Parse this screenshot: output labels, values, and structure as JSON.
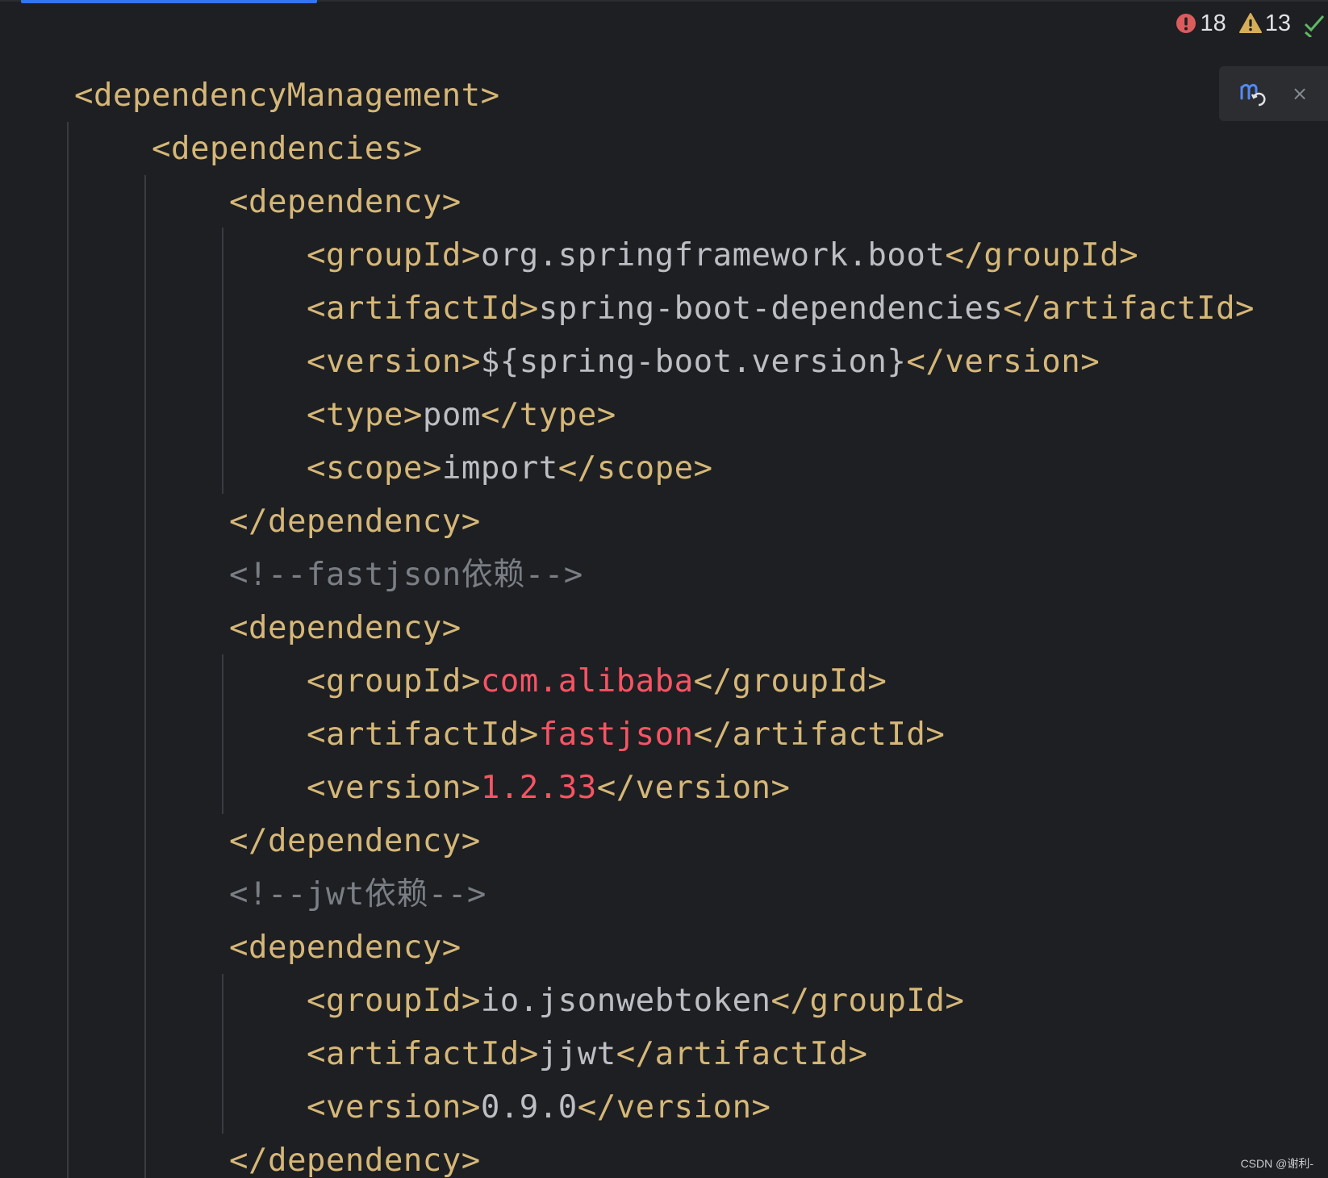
{
  "inspections": {
    "errors": "18",
    "warnings": "13"
  },
  "maven_popup": {
    "icon": "maven-reload-icon",
    "close_glyph": "×"
  },
  "code_lines": [
    {
      "indent": 1,
      "segments": [
        {
          "t": "<dependencyManagement>",
          "k": "tag"
        }
      ]
    },
    {
      "indent": 2,
      "segments": [
        {
          "t": "<dependencies>",
          "k": "tag"
        }
      ]
    },
    {
      "indent": 3,
      "segments": [
        {
          "t": "<dependency>",
          "k": "tag"
        }
      ]
    },
    {
      "indent": 4,
      "segments": [
        {
          "t": "<groupId>",
          "k": "tag"
        },
        {
          "t": "org.springframework.boot",
          "k": "text"
        },
        {
          "t": "</groupId>",
          "k": "tag"
        }
      ]
    },
    {
      "indent": 4,
      "segments": [
        {
          "t": "<artifactId>",
          "k": "tag"
        },
        {
          "t": "spring-boot-dependencies",
          "k": "text"
        },
        {
          "t": "</artifactId>",
          "k": "tag"
        }
      ]
    },
    {
      "indent": 4,
      "segments": [
        {
          "t": "<version>",
          "k": "tag"
        },
        {
          "t": "${spring-boot.version}",
          "k": "text"
        },
        {
          "t": "</version>",
          "k": "tag"
        }
      ]
    },
    {
      "indent": 4,
      "segments": [
        {
          "t": "<type>",
          "k": "tag"
        },
        {
          "t": "pom",
          "k": "text"
        },
        {
          "t": "</type>",
          "k": "tag"
        }
      ]
    },
    {
      "indent": 4,
      "segments": [
        {
          "t": "<scope>",
          "k": "tag"
        },
        {
          "t": "import",
          "k": "text"
        },
        {
          "t": "</scope>",
          "k": "tag"
        }
      ]
    },
    {
      "indent": 3,
      "segments": [
        {
          "t": "</dependency>",
          "k": "tag"
        }
      ]
    },
    {
      "indent": 3,
      "segments": [
        {
          "t": "<!--fastjson依赖-->",
          "k": "comment"
        }
      ]
    },
    {
      "indent": 3,
      "segments": [
        {
          "t": "<dependency>",
          "k": "tag"
        }
      ]
    },
    {
      "indent": 4,
      "segments": [
        {
          "t": "<groupId>",
          "k": "tag"
        },
        {
          "t": "com.alibaba",
          "k": "err"
        },
        {
          "t": "</groupId>",
          "k": "tag"
        }
      ]
    },
    {
      "indent": 4,
      "segments": [
        {
          "t": "<artifactId>",
          "k": "tag"
        },
        {
          "t": "fastjson",
          "k": "err"
        },
        {
          "t": "</artifactId>",
          "k": "tag"
        }
      ]
    },
    {
      "indent": 4,
      "segments": [
        {
          "t": "<version>",
          "k": "tag"
        },
        {
          "t": "1.2.33",
          "k": "err"
        },
        {
          "t": "</version>",
          "k": "tag"
        }
      ]
    },
    {
      "indent": 3,
      "segments": [
        {
          "t": "</dependency>",
          "k": "tag"
        }
      ]
    },
    {
      "indent": 3,
      "segments": [
        {
          "t": "<!--jwt依赖-->",
          "k": "comment"
        }
      ]
    },
    {
      "indent": 3,
      "segments": [
        {
          "t": "<dependency>",
          "k": "tag"
        }
      ]
    },
    {
      "indent": 4,
      "segments": [
        {
          "t": "<groupId>",
          "k": "tag"
        },
        {
          "t": "io.jsonwebtoken",
          "k": "text"
        },
        {
          "t": "</groupId>",
          "k": "tag"
        }
      ]
    },
    {
      "indent": 4,
      "segments": [
        {
          "t": "<artifactId>",
          "k": "tag"
        },
        {
          "t": "jjwt",
          "k": "text"
        },
        {
          "t": "</artifactId>",
          "k": "tag"
        }
      ]
    },
    {
      "indent": 4,
      "segments": [
        {
          "t": "<version>",
          "k": "tag"
        },
        {
          "t": "0.9.0",
          "k": "text"
        },
        {
          "t": "</version>",
          "k": "tag"
        }
      ]
    },
    {
      "indent": 3,
      "segments": [
        {
          "t": "</dependency>",
          "k": "tag"
        }
      ]
    }
  ],
  "colors": {
    "background": "#1e1f22",
    "tag": "#d5b778",
    "text": "#bcbec4",
    "error_text": "#f75464",
    "comment": "#7a7e85",
    "error_icon": "#db5c5c",
    "warning_icon": "#d6ae58",
    "check_icon": "#5fb865",
    "accent": "#3574f0"
  },
  "watermark": "CSDN @谢利-"
}
